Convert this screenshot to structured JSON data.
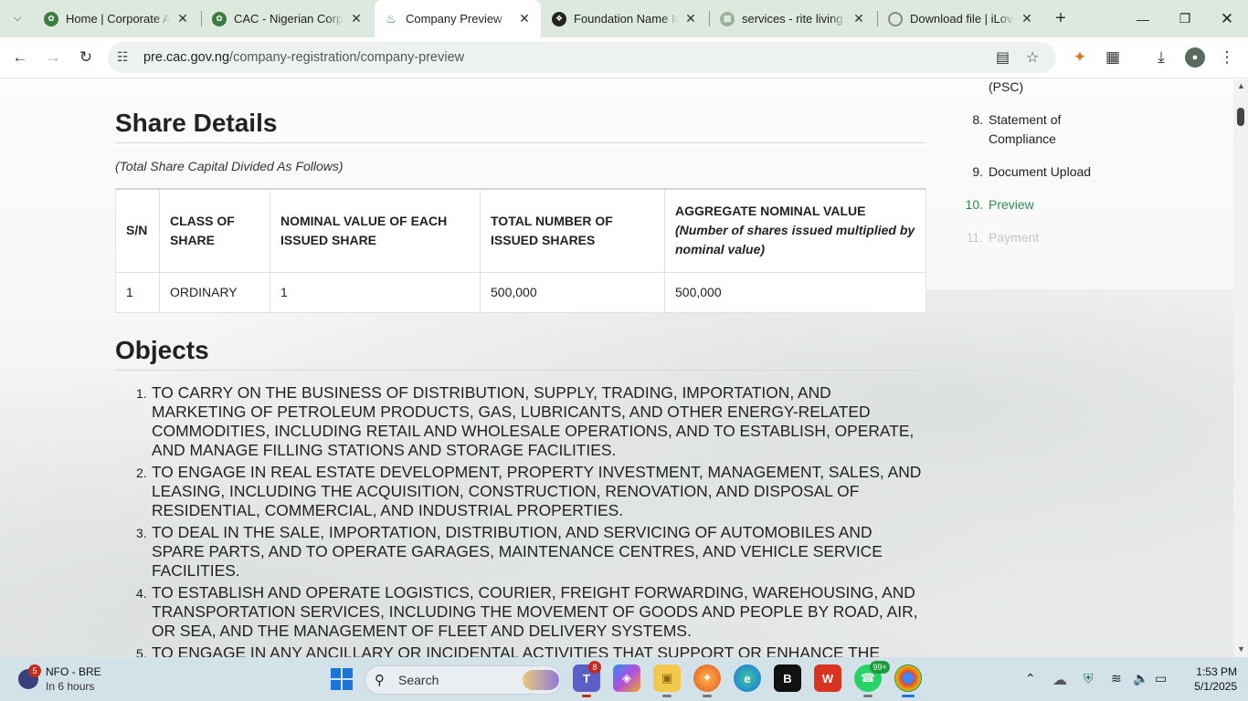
{
  "browser": {
    "tabs": [
      {
        "title": "Home | Corporate Aff",
        "active": false
      },
      {
        "title": "CAC - Nigerian Corpo",
        "active": false
      },
      {
        "title": "Company Preview",
        "active": true
      },
      {
        "title": "Foundation Name Ide",
        "active": false
      },
      {
        "title": "services - rite living s",
        "active": false
      },
      {
        "title": "Download file | iLove",
        "active": false
      }
    ],
    "url_host": "pre.cac.gov.ng",
    "url_path": "/company-registration/company-preview"
  },
  "share_details": {
    "heading": "Share Details",
    "note": "(Total Share Capital Divided As Follows)",
    "columns": {
      "sn": "S/N",
      "class": "CLASS OF SHARE",
      "nominal": "NOMINAL VALUE OF EACH ISSUED SHARE",
      "total": "TOTAL NUMBER OF ISSUED SHARES",
      "aggregate": "AGGREGATE NOMINAL VALUE",
      "aggregate_note": "(Number of shares issued multiplied by nominal value)"
    },
    "rows": [
      {
        "sn": "1",
        "class": "ORDINARY",
        "nominal": "1",
        "total": "500,000",
        "aggregate": "500,000"
      }
    ]
  },
  "objects": {
    "heading": "Objects",
    "items": [
      "TO CARRY ON THE BUSINESS OF DISTRIBUTION, SUPPLY, TRADING, IMPORTATION, AND MARKETING OF PETROLEUM PRODUCTS, GAS, LUBRICANTS, AND OTHER ENERGY-RELATED COMMODITIES, INCLUDING RETAIL AND WHOLESALE OPERATIONS, AND TO ESTABLISH, OPERATE, AND MANAGE FILLING STATIONS AND STORAGE FACILITIES.",
      "TO ENGAGE IN REAL ESTATE DEVELOPMENT, PROPERTY INVESTMENT, MANAGEMENT, SALES, AND LEASING, INCLUDING THE ACQUISITION, CONSTRUCTION, RENOVATION, AND DISPOSAL OF RESIDENTIAL, COMMERCIAL, AND INDUSTRIAL PROPERTIES.",
      "TO DEAL IN THE SALE, IMPORTATION, DISTRIBUTION, AND SERVICING OF AUTOMOBILES AND SPARE PARTS, AND TO OPERATE GARAGES, MAINTENANCE CENTRES, AND VEHICLE SERVICE FACILITIES.",
      "TO ESTABLISH AND OPERATE LOGISTICS, COURIER, FREIGHT FORWARDING, WAREHOUSING, AND TRANSPORTATION SERVICES, INCLUDING THE MOVEMENT OF GOODS AND PEOPLE BY ROAD, AIR, OR SEA, AND THE MANAGEMENT OF FLEET AND DELIVERY SYSTEMS.",
      "TO ENGAGE IN ANY ANCILLARY OR INCIDENTAL ACTIVITIES THAT SUPPORT OR ENHANCE THE FOREGOING OBJECTS, INCLUDING CONSULTANCY, PROJECT MANAGEMENT, PROCUREMENT, AND"
    ]
  },
  "steps": [
    {
      "num": "",
      "label": "(PSC)",
      "state": "done"
    },
    {
      "num": "8.",
      "label": "Statement of Compliance",
      "state": "done"
    },
    {
      "num": "9.",
      "label": "Document Upload",
      "state": "done"
    },
    {
      "num": "10.",
      "label": "Preview",
      "state": "current"
    },
    {
      "num": "11.",
      "label": "Payment",
      "state": "disabled"
    }
  ],
  "colors": {
    "current_step": "#2e8b57",
    "disabled_step": "#c4c8c5",
    "tabstrip": "#dde8df"
  },
  "taskbar": {
    "weather_line1": "NFO - BRE",
    "weather_line2": "In 6 hours",
    "weather_badge": "5",
    "search_label": "Search",
    "teams_badge": "8",
    "whatsapp_badge": "99+",
    "time": "1:53 PM",
    "date": "5/1/2025"
  }
}
